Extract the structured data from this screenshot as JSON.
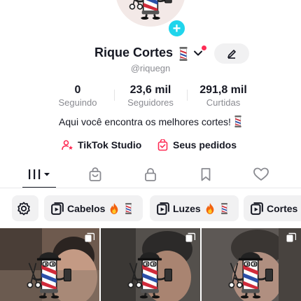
{
  "profile": {
    "display_name": "Rique Cortes",
    "username": "@riquegn",
    "avatar_icon": "barber-mascot-avatar",
    "name_emoji": "barber-pole-emoji",
    "notification_dot_color": "#fe2c55",
    "add_button_color": "#20d5ec",
    "add_symbol": "+"
  },
  "stats": [
    {
      "value": "0",
      "label": "Seguindo"
    },
    {
      "value": "23,6 mil",
      "label": "Seguidores"
    },
    {
      "value": "291,8 mil",
      "label": "Curtidas"
    }
  ],
  "bio": {
    "text": "Aqui você encontra os melhores cortes!",
    "emoji": "barber-pole-emoji"
  },
  "links": [
    {
      "label": "TikTok Studio",
      "icon": "person-star-icon"
    },
    {
      "label": "Seus pedidos",
      "icon": "order-bag-icon"
    }
  ],
  "tabs": [
    {
      "name": "videos",
      "icon": "grid-bars-icon",
      "selected": true
    },
    {
      "name": "shop",
      "icon": "shopping-bag-icon",
      "selected": false
    },
    {
      "name": "private",
      "icon": "lock-icon",
      "selected": false
    },
    {
      "name": "saved",
      "icon": "bookmark-icon",
      "selected": false
    },
    {
      "name": "liked",
      "icon": "heart-icon",
      "selected": false
    }
  ],
  "playlists": {
    "settings_icon": "gear-icon",
    "chips": [
      {
        "label": "Cabelos",
        "icon": "playlist-icon",
        "emojis": [
          "fire-emoji",
          "barber-pole-emoji"
        ]
      },
      {
        "label": "Luzes",
        "icon": "playlist-icon",
        "emojis": [
          "fire-emoji",
          "barber-pole-emoji"
        ]
      },
      {
        "label": "Cortes",
        "icon": "playlist-icon",
        "emojis": []
      }
    ]
  },
  "videos": [
    {
      "thumbnail": "barber-mascot-thumbnail",
      "multi_icon": "carousel-icon"
    },
    {
      "thumbnail": "barber-mascot-thumbnail",
      "multi_icon": "carousel-icon"
    },
    {
      "thumbnail": "barber-mascot-thumbnail",
      "multi_icon": "carousel-icon"
    }
  ],
  "colors": {
    "text_primary": "#161823",
    "text_secondary": "#8a8b91",
    "accent_red": "#fe2c55",
    "chip_bg": "#f1f1f2"
  }
}
